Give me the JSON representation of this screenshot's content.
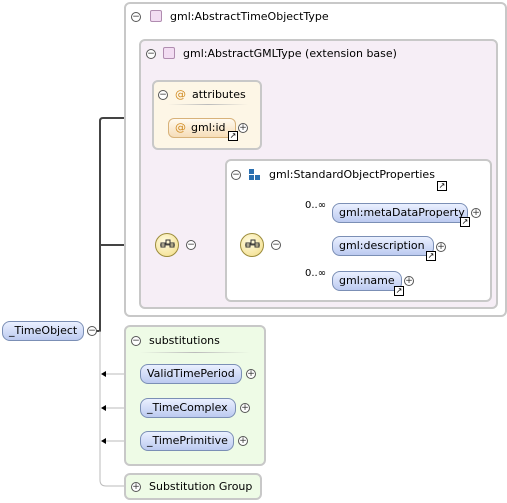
{
  "types": {
    "outer_title": "gml:AbstractTimeObjectType",
    "inner_title": "gml:AbstractGMLType (extension base)"
  },
  "attributes": {
    "title": "attributes",
    "at_symbol": "@",
    "items": [
      "gml:id"
    ]
  },
  "properties_group": {
    "title": "gml:StandardObjectProperties",
    "items": [
      {
        "label": "gml:metaDataProperty",
        "occurs": "0..∞"
      },
      {
        "label": "gml:description",
        "occurs": ""
      },
      {
        "label": "gml:name",
        "occurs": "0..∞"
      }
    ]
  },
  "root_element": "_TimeObject",
  "substitutions": {
    "title": "substitutions",
    "items": [
      "ValidTimePeriod",
      "_TimeComplex",
      "_TimePrimitive"
    ]
  },
  "substitution_group": {
    "title": "Substitution Group"
  },
  "glyphs": {
    "collapse": "−",
    "expand": "+",
    "link": "↗"
  },
  "colors": {
    "type_border": "#c8c8c8",
    "type_fill": "#f6eef6",
    "attribute_fill": "#fdf6e6",
    "substitution_fill": "#eefbe6",
    "element_pill": "#bccaf0"
  }
}
